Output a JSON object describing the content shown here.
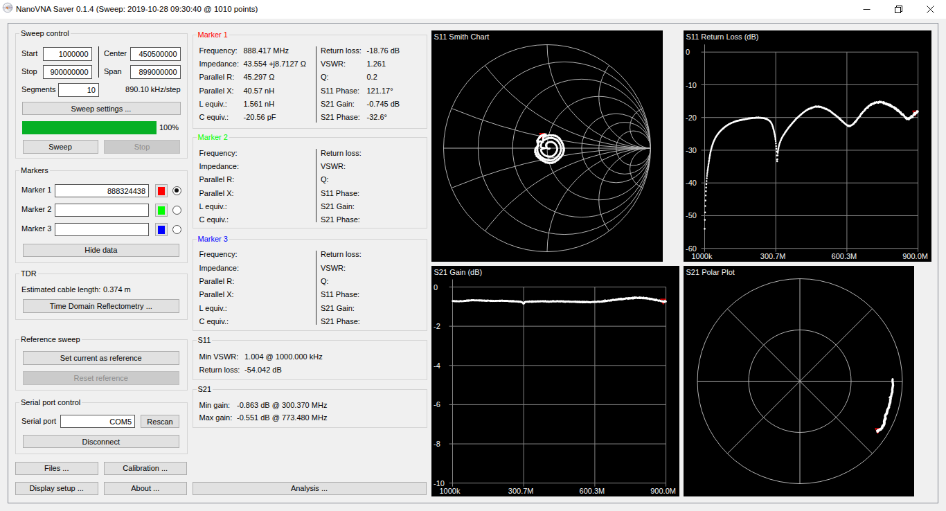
{
  "window": {
    "title": "NanoVNA Saver 0.1.4 (Sweep: 2019-10-28 09:30:40 @ 1010 points)"
  },
  "colors": {
    "progress_green": "#06b025",
    "marker1": "#ff0000",
    "marker2": "#00ff00",
    "marker3": "#0000ff",
    "chart_background": "#000000",
    "chart_grid": "#a8a8a8",
    "chart_text": "#f2f2f2",
    "trace": "#ffffff"
  },
  "sweep_control": {
    "title": "Sweep control",
    "start_label": "Start",
    "start_value": "1000000",
    "stop_label": "Stop",
    "stop_value": "900000000",
    "center_label": "Center",
    "center_value": "450500000",
    "span_label": "Span",
    "span_value": "899000000",
    "segments_label": "Segments",
    "segments_value": "10",
    "step_text": "890.10 kHz/step",
    "sweep_settings_button": "Sweep settings ...",
    "progress_label": "100%",
    "progress_value": 100,
    "sweep_button": "Sweep",
    "stop_button": "Stop"
  },
  "markers_panel": {
    "title": "Markers",
    "rows": [
      {
        "label": "Marker 1",
        "value": "888324438",
        "color": "#ff0000",
        "selected": true
      },
      {
        "label": "Marker 2",
        "value": "",
        "color": "#00ff00",
        "selected": false
      },
      {
        "label": "Marker 3",
        "value": "",
        "color": "#0000ff",
        "selected": false
      }
    ],
    "hide_data_button": "Hide data"
  },
  "tdr": {
    "title": "TDR",
    "cable_length_label": "Estimated cable length:",
    "cable_length_value": "0.374 m",
    "button": "Time Domain Reflectometry ..."
  },
  "reference": {
    "title": "Reference sweep",
    "set_button": "Set current as reference",
    "reset_button": "Reset reference"
  },
  "serial": {
    "title": "Serial port control",
    "port_label": "Serial port",
    "port_value": "COM5",
    "rescan_button": "Rescan",
    "disconnect_button": "Disconnect"
  },
  "bottom_buttons": {
    "files": "Files ...",
    "calibration": "Calibration ...",
    "display_setup": "Display setup ...",
    "about": "About ...",
    "analysis": "Analysis ..."
  },
  "marker_boxes": [
    {
      "title": "Marker 1",
      "color": "#ff0000",
      "left": [
        [
          "Frequency:",
          "888.417 MHz"
        ],
        [
          "Impedance:",
          "43.554 +j8.7127 Ω"
        ],
        [
          "Parallel R:",
          "45.297 Ω"
        ],
        [
          "Parallel X:",
          "40.57 nH"
        ],
        [
          "L equiv.:",
          "1.561 nH"
        ],
        [
          "C equiv.:",
          "-20.56 pF"
        ]
      ],
      "right": [
        [
          "Return loss:",
          "-18.76 dB"
        ],
        [
          "VSWR:",
          "1.261"
        ],
        [
          "Q:",
          "0.2"
        ],
        [
          "S11 Phase:",
          "121.17°"
        ],
        [
          "S21 Gain:",
          "-0.745 dB"
        ],
        [
          "S21 Phase:",
          "-32.6°"
        ]
      ]
    },
    {
      "title": "Marker 2",
      "color": "#00ff00",
      "left": [
        [
          "Frequency:",
          ""
        ],
        [
          "Impedance:",
          ""
        ],
        [
          "Parallel R:",
          ""
        ],
        [
          "Parallel X:",
          ""
        ],
        [
          "L equiv.:",
          ""
        ],
        [
          "C equiv.:",
          ""
        ]
      ],
      "right": [
        [
          "Return loss:",
          ""
        ],
        [
          "VSWR:",
          ""
        ],
        [
          "Q:",
          ""
        ],
        [
          "S11 Phase:",
          ""
        ],
        [
          "S21 Gain:",
          ""
        ],
        [
          "S21 Phase:",
          ""
        ]
      ]
    },
    {
      "title": "Marker 3",
      "color": "#0000ff",
      "left": [
        [
          "Frequency:",
          ""
        ],
        [
          "Impedance:",
          ""
        ],
        [
          "Parallel R:",
          ""
        ],
        [
          "Parallel X:",
          ""
        ],
        [
          "L equiv.:",
          ""
        ],
        [
          "C equiv.:",
          ""
        ]
      ],
      "right": [
        [
          "Return loss:",
          ""
        ],
        [
          "VSWR:",
          ""
        ],
        [
          "Q:",
          ""
        ],
        [
          "S11 Phase:",
          ""
        ],
        [
          "S21 Gain:",
          ""
        ],
        [
          "S21 Phase:",
          ""
        ]
      ]
    }
  ],
  "s11_info": {
    "title": "S11",
    "rows": [
      [
        "Min VSWR:",
        "1.004 @ 1000.000 kHz"
      ],
      [
        "Return loss:",
        "-54.042 dB"
      ]
    ]
  },
  "s21_info": {
    "title": "S21",
    "rows": [
      [
        "Min gain:",
        "-0.863 dB @ 300.370 MHz"
      ],
      [
        "Max gain:",
        "-0.551 dB @ 773.480 MHz"
      ]
    ]
  },
  "chart_data": [
    {
      "type": "smith",
      "title": "S11 Smith Chart",
      "resistance_circles_normalized": [
        0.2,
        0.5,
        1,
        2,
        3,
        5
      ],
      "reactance_arcs_normalized": [
        0.2,
        0.5,
        1,
        2,
        5
      ],
      "sweep_points": 1010,
      "f_range_mhz": [
        1,
        900
      ],
      "phase_model": {
        "marker_freq_mhz": 888.417,
        "marker_phase_deg": 121.17,
        "rate_deg_per_mhz": -1.335
      },
      "loop_radius_curve_mhz_mag": [
        [
          1,
          0.002
        ],
        [
          10,
          0.007
        ],
        [
          25,
          0.013
        ],
        [
          40,
          0.026
        ],
        [
          60,
          0.042
        ],
        [
          76,
          0.054
        ],
        [
          110,
          0.0625
        ],
        [
          160,
          0.0695
        ],
        [
          230,
          0.079
        ],
        [
          305,
          0.088
        ],
        [
          381,
          0.102
        ],
        [
          450,
          0.109
        ],
        [
          530,
          0.117
        ],
        [
          610,
          0.124
        ],
        [
          686,
          0.133
        ],
        [
          740,
          0.1365
        ],
        [
          800,
          0.1395
        ],
        [
          850,
          0.141
        ],
        [
          900,
          0.1425
        ]
      ],
      "radius_dips": [
        {
          "f": 305,
          "depth": 0.71,
          "width": 4
        },
        {
          "f": 610,
          "depth": 0.33,
          "width": 7
        },
        {
          "f": 855,
          "depth": 0.23,
          "width": 8
        }
      ],
      "marker": {
        "freq_mhz": 888.417,
        "s11_db": -18.76,
        "phase_deg": 121.17,
        "color": "#ff0000"
      }
    },
    {
      "type": "line",
      "title": "S11 Return Loss (dB)",
      "ylabel": "dB",
      "ylim": [
        -60,
        0
      ],
      "y_ticks": [
        "0",
        "-10",
        "-20",
        "-30",
        "-40",
        "-50",
        "-60"
      ],
      "x_tick_labels": [
        "1000k",
        "300.7M",
        "600.3M",
        "900.0M"
      ],
      "x_range_mhz": [
        1,
        900
      ],
      "sweep_points": 1010,
      "curve_mhz_db": [
        [
          1,
          -54.0
        ],
        [
          2,
          -51.0
        ],
        [
          3,
          -48.5
        ],
        [
          4.5,
          -45.5
        ],
        [
          6,
          -43.0
        ],
        [
          8,
          -40.5
        ],
        [
          10,
          -38.5
        ],
        [
          13,
          -36.5
        ],
        [
          17,
          -34.5
        ],
        [
          21,
          -32.5
        ],
        [
          26,
          -30.5
        ],
        [
          32,
          -28.8
        ],
        [
          40,
          -27.2
        ],
        [
          50,
          -25.8
        ],
        [
          62,
          -24.6
        ],
        [
          75,
          -23.6
        ],
        [
          90,
          -22.7
        ],
        [
          105,
          -22.0
        ],
        [
          120,
          -21.5
        ],
        [
          140,
          -21.0
        ],
        [
          160,
          -20.7
        ],
        [
          180,
          -20.4
        ],
        [
          200,
          -20.2
        ],
        [
          230,
          -20.1
        ],
        [
          255,
          -20.3
        ],
        [
          270,
          -20.8
        ],
        [
          280,
          -21.5
        ],
        [
          288,
          -22.8
        ],
        [
          295,
          -24.8
        ],
        [
          300,
          -27.0
        ],
        [
          304,
          -30.5
        ],
        [
          306.5,
          -33.4
        ],
        [
          309,
          -31.0
        ],
        [
          313,
          -29.0
        ],
        [
          318,
          -27.7
        ],
        [
          325,
          -26.5
        ],
        [
          335,
          -25.2
        ],
        [
          350,
          -23.6
        ],
        [
          370,
          -21.8
        ],
        [
          390,
          -20.2
        ],
        [
          410,
          -18.9
        ],
        [
          430,
          -17.8
        ],
        [
          450,
          -17.1
        ],
        [
          470,
          -16.7
        ],
        [
          490,
          -16.8
        ],
        [
          510,
          -17.3
        ],
        [
          530,
          -18.1
        ],
        [
          550,
          -19.2
        ],
        [
          570,
          -20.4
        ],
        [
          585,
          -21.4
        ],
        [
          600,
          -22.3
        ],
        [
          610,
          -22.6
        ],
        [
          622,
          -22.3
        ],
        [
          635,
          -21.4
        ],
        [
          650,
          -20.0
        ],
        [
          665,
          -18.6
        ],
        [
          680,
          -17.4
        ],
        [
          695,
          -16.4
        ],
        [
          710,
          -15.8
        ],
        [
          725,
          -15.4
        ],
        [
          740,
          -15.3
        ],
        [
          755,
          -15.5
        ],
        [
          770,
          -15.9
        ],
        [
          785,
          -16.4
        ],
        [
          800,
          -17.0
        ],
        [
          815,
          -17.8
        ],
        [
          830,
          -18.8
        ],
        [
          842,
          -19.6
        ],
        [
          855,
          -20.4
        ],
        [
          865,
          -20.2
        ],
        [
          875,
          -19.7
        ],
        [
          882,
          -19.2
        ],
        [
          888.4,
          -18.76
        ],
        [
          894,
          -18.4
        ],
        [
          900,
          -18.2
        ]
      ],
      "marker": {
        "freq_mhz": 888.417,
        "db": -18.76,
        "color": "#ff0000"
      }
    },
    {
      "type": "line",
      "title": "S21 Gain (dB)",
      "ylabel": "dB",
      "ylim": [
        -10,
        0
      ],
      "y_ticks": [
        "0",
        "-2",
        "-4",
        "-6",
        "-8",
        "-10"
      ],
      "x_tick_labels": [
        "1000k",
        "300.7M",
        "600.3M",
        "900.0M"
      ],
      "x_range_mhz": [
        1,
        900
      ],
      "sweep_points": 1010,
      "curve_mhz_db": [
        [
          1,
          -0.72
        ],
        [
          30,
          -0.73
        ],
        [
          60,
          -0.7
        ],
        [
          90,
          -0.68
        ],
        [
          120,
          -0.69
        ],
        [
          150,
          -0.7
        ],
        [
          180,
          -0.71
        ],
        [
          210,
          -0.7
        ],
        [
          240,
          -0.72
        ],
        [
          270,
          -0.74
        ],
        [
          295,
          -0.78
        ],
        [
          300.4,
          -0.86
        ],
        [
          305,
          -0.78
        ],
        [
          320,
          -0.75
        ],
        [
          350,
          -0.74
        ],
        [
          380,
          -0.73
        ],
        [
          410,
          -0.74
        ],
        [
          440,
          -0.73
        ],
        [
          470,
          -0.74
        ],
        [
          500,
          -0.75
        ],
        [
          530,
          -0.76
        ],
        [
          560,
          -0.765
        ],
        [
          590,
          -0.765
        ],
        [
          620,
          -0.75
        ],
        [
          650,
          -0.71
        ],
        [
          680,
          -0.66
        ],
        [
          710,
          -0.615
        ],
        [
          740,
          -0.585
        ],
        [
          773.5,
          -0.551
        ],
        [
          800,
          -0.56
        ],
        [
          825,
          -0.59
        ],
        [
          850,
          -0.64
        ],
        [
          870,
          -0.69
        ],
        [
          888.4,
          -0.745
        ],
        [
          900,
          -0.75
        ]
      ],
      "marker": {
        "freq_mhz": 888.417,
        "db": -0.745,
        "color": "#ff0000"
      }
    },
    {
      "type": "polar",
      "title": "S21 Polar Plot",
      "rings_normalized": [
        1,
        0.5
      ],
      "spokes_every_deg": 45,
      "sweep_points": 1010,
      "f_range_mhz": [
        1,
        900
      ],
      "phase_model": {
        "start_phase_deg": 1.2,
        "marker_freq_mhz": 888.417,
        "marker_phase_deg": -32.6
      },
      "marker": {
        "freq_mhz": 888.417,
        "s21_db": -0.745,
        "phase_deg": -32.6,
        "color": "#ff0000"
      }
    }
  ]
}
